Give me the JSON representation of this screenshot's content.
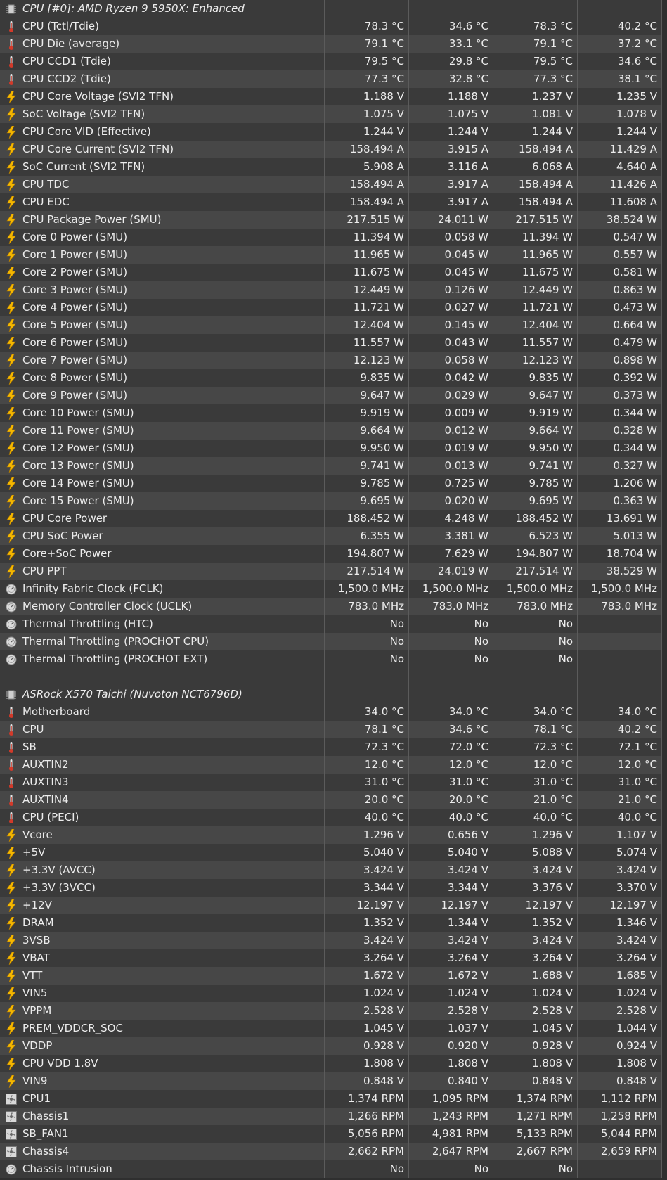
{
  "columns": [
    "",
    "",
    "",
    ""
  ],
  "sections": [
    {
      "title": "CPU [#0]: AMD Ryzen 9 5950X: Enhanced",
      "icon": "chip-icon",
      "rows": [
        {
          "label": "CPU (Tctl/Tdie)",
          "icon": "thermometer-icon",
          "values": [
            "78.3 °C",
            "34.6 °C",
            "78.3 °C",
            "40.2 °C"
          ]
        },
        {
          "label": "CPU Die (average)",
          "icon": "thermometer-icon",
          "values": [
            "79.1 °C",
            "33.1 °C",
            "79.1 °C",
            "37.2 °C"
          ]
        },
        {
          "label": "CPU CCD1 (Tdie)",
          "icon": "thermometer-icon",
          "values": [
            "79.5 °C",
            "29.8 °C",
            "79.5 °C",
            "34.6 °C"
          ]
        },
        {
          "label": "CPU CCD2 (Tdie)",
          "icon": "thermometer-icon",
          "values": [
            "77.3 °C",
            "32.8 °C",
            "77.3 °C",
            "38.1 °C"
          ]
        },
        {
          "label": "CPU Core Voltage (SVI2 TFN)",
          "icon": "lightning-icon",
          "values": [
            "1.188 V",
            "1.188 V",
            "1.237 V",
            "1.235 V"
          ]
        },
        {
          "label": "SoC Voltage (SVI2 TFN)",
          "icon": "lightning-icon",
          "values": [
            "1.075 V",
            "1.075 V",
            "1.081 V",
            "1.078 V"
          ]
        },
        {
          "label": "CPU Core VID (Effective)",
          "icon": "lightning-icon",
          "values": [
            "1.244 V",
            "1.244 V",
            "1.244 V",
            "1.244 V"
          ]
        },
        {
          "label": "CPU Core Current (SVI2 TFN)",
          "icon": "lightning-icon",
          "values": [
            "158.494 A",
            "3.915 A",
            "158.494 A",
            "11.429 A"
          ]
        },
        {
          "label": "SoC Current (SVI2 TFN)",
          "icon": "lightning-icon",
          "values": [
            "5.908 A",
            "3.116 A",
            "6.068 A",
            "4.640 A"
          ]
        },
        {
          "label": "CPU TDC",
          "icon": "lightning-icon",
          "values": [
            "158.494 A",
            "3.917 A",
            "158.494 A",
            "11.426 A"
          ]
        },
        {
          "label": "CPU EDC",
          "icon": "lightning-icon",
          "values": [
            "158.494 A",
            "3.917 A",
            "158.494 A",
            "11.608 A"
          ]
        },
        {
          "label": "CPU Package Power (SMU)",
          "icon": "lightning-icon",
          "values": [
            "217.515 W",
            "24.011 W",
            "217.515 W",
            "38.524 W"
          ]
        },
        {
          "label": "Core 0 Power (SMU)",
          "icon": "lightning-icon",
          "values": [
            "11.394 W",
            "0.058 W",
            "11.394 W",
            "0.547 W"
          ]
        },
        {
          "label": "Core 1 Power (SMU)",
          "icon": "lightning-icon",
          "values": [
            "11.965 W",
            "0.045 W",
            "11.965 W",
            "0.557 W"
          ]
        },
        {
          "label": "Core 2 Power (SMU)",
          "icon": "lightning-icon",
          "values": [
            "11.675 W",
            "0.045 W",
            "11.675 W",
            "0.581 W"
          ]
        },
        {
          "label": "Core 3 Power (SMU)",
          "icon": "lightning-icon",
          "values": [
            "12.449 W",
            "0.126 W",
            "12.449 W",
            "0.863 W"
          ]
        },
        {
          "label": "Core 4 Power (SMU)",
          "icon": "lightning-icon",
          "values": [
            "11.721 W",
            "0.027 W",
            "11.721 W",
            "0.473 W"
          ]
        },
        {
          "label": "Core 5 Power (SMU)",
          "icon": "lightning-icon",
          "values": [
            "12.404 W",
            "0.145 W",
            "12.404 W",
            "0.664 W"
          ]
        },
        {
          "label": "Core 6 Power (SMU)",
          "icon": "lightning-icon",
          "values": [
            "11.557 W",
            "0.043 W",
            "11.557 W",
            "0.479 W"
          ]
        },
        {
          "label": "Core 7 Power (SMU)",
          "icon": "lightning-icon",
          "values": [
            "12.123 W",
            "0.058 W",
            "12.123 W",
            "0.898 W"
          ]
        },
        {
          "label": "Core 8 Power (SMU)",
          "icon": "lightning-icon",
          "values": [
            "9.835 W",
            "0.042 W",
            "9.835 W",
            "0.392 W"
          ]
        },
        {
          "label": "Core 9 Power (SMU)",
          "icon": "lightning-icon",
          "values": [
            "9.647 W",
            "0.029 W",
            "9.647 W",
            "0.373 W"
          ]
        },
        {
          "label": "Core 10 Power (SMU)",
          "icon": "lightning-icon",
          "values": [
            "9.919 W",
            "0.009 W",
            "9.919 W",
            "0.344 W"
          ]
        },
        {
          "label": "Core 11 Power (SMU)",
          "icon": "lightning-icon",
          "values": [
            "9.664 W",
            "0.012 W",
            "9.664 W",
            "0.328 W"
          ]
        },
        {
          "label": "Core 12 Power (SMU)",
          "icon": "lightning-icon",
          "values": [
            "9.950 W",
            "0.019 W",
            "9.950 W",
            "0.344 W"
          ]
        },
        {
          "label": "Core 13 Power (SMU)",
          "icon": "lightning-icon",
          "values": [
            "9.741 W",
            "0.013 W",
            "9.741 W",
            "0.327 W"
          ]
        },
        {
          "label": "Core 14 Power (SMU)",
          "icon": "lightning-icon",
          "values": [
            "9.785 W",
            "0.725 W",
            "9.785 W",
            "1.206 W"
          ]
        },
        {
          "label": "Core 15 Power (SMU)",
          "icon": "lightning-icon",
          "values": [
            "9.695 W",
            "0.020 W",
            "9.695 W",
            "0.363 W"
          ]
        },
        {
          "label": "CPU Core Power",
          "icon": "lightning-icon",
          "values": [
            "188.452 W",
            "4.248 W",
            "188.452 W",
            "13.691 W"
          ]
        },
        {
          "label": "CPU SoC Power",
          "icon": "lightning-icon",
          "values": [
            "6.355 W",
            "3.381 W",
            "6.523 W",
            "5.013 W"
          ]
        },
        {
          "label": "Core+SoC Power",
          "icon": "lightning-icon",
          "values": [
            "194.807 W",
            "7.629 W",
            "194.807 W",
            "18.704 W"
          ]
        },
        {
          "label": "CPU PPT",
          "icon": "lightning-icon",
          "values": [
            "217.514 W",
            "24.019 W",
            "217.514 W",
            "38.529 W"
          ]
        },
        {
          "label": "Infinity Fabric Clock (FCLK)",
          "icon": "clock-icon",
          "values": [
            "1,500.0 MHz",
            "1,500.0 MHz",
            "1,500.0 MHz",
            "1,500.0 MHz"
          ]
        },
        {
          "label": "Memory Controller Clock (UCLK)",
          "icon": "clock-icon",
          "values": [
            "783.0 MHz",
            "783.0 MHz",
            "783.0 MHz",
            "783.0 MHz"
          ]
        },
        {
          "label": "Thermal Throttling (HTC)",
          "icon": "clock-icon",
          "values": [
            "No",
            "No",
            "No",
            ""
          ]
        },
        {
          "label": "Thermal Throttling (PROCHOT CPU)",
          "icon": "clock-icon",
          "values": [
            "No",
            "No",
            "No",
            ""
          ]
        },
        {
          "label": "Thermal Throttling (PROCHOT EXT)",
          "icon": "clock-icon",
          "values": [
            "No",
            "No",
            "No",
            ""
          ]
        }
      ]
    },
    {
      "title": "ASRock X570 Taichi (Nuvoton NCT6796D)",
      "icon": "chip-icon",
      "rows": [
        {
          "label": "Motherboard",
          "icon": "thermometer-icon",
          "values": [
            "34.0 °C",
            "34.0 °C",
            "34.0 °C",
            "34.0 °C"
          ]
        },
        {
          "label": "CPU",
          "icon": "thermometer-icon",
          "values": [
            "78.1 °C",
            "34.6 °C",
            "78.1 °C",
            "40.2 °C"
          ]
        },
        {
          "label": "SB",
          "icon": "thermometer-icon",
          "values": [
            "72.3 °C",
            "72.0 °C",
            "72.3 °C",
            "72.1 °C"
          ]
        },
        {
          "label": "AUXTIN2",
          "icon": "thermometer-icon",
          "values": [
            "12.0 °C",
            "12.0 °C",
            "12.0 °C",
            "12.0 °C"
          ]
        },
        {
          "label": "AUXTIN3",
          "icon": "thermometer-icon",
          "values": [
            "31.0 °C",
            "31.0 °C",
            "31.0 °C",
            "31.0 °C"
          ]
        },
        {
          "label": "AUXTIN4",
          "icon": "thermometer-icon",
          "values": [
            "20.0 °C",
            "20.0 °C",
            "21.0 °C",
            "21.0 °C"
          ]
        },
        {
          "label": "CPU (PECI)",
          "icon": "thermometer-icon",
          "values": [
            "40.0 °C",
            "40.0 °C",
            "40.0 °C",
            "40.0 °C"
          ]
        },
        {
          "label": "Vcore",
          "icon": "lightning-icon",
          "values": [
            "1.296 V",
            "0.656 V",
            "1.296 V",
            "1.107 V"
          ]
        },
        {
          "label": "+5V",
          "icon": "lightning-icon",
          "values": [
            "5.040 V",
            "5.040 V",
            "5.088 V",
            "5.074 V"
          ]
        },
        {
          "label": "+3.3V (AVCC)",
          "icon": "lightning-icon",
          "values": [
            "3.424 V",
            "3.424 V",
            "3.424 V",
            "3.424 V"
          ]
        },
        {
          "label": "+3.3V (3VCC)",
          "icon": "lightning-icon",
          "values": [
            "3.344 V",
            "3.344 V",
            "3.376 V",
            "3.370 V"
          ]
        },
        {
          "label": "+12V",
          "icon": "lightning-icon",
          "values": [
            "12.197 V",
            "12.197 V",
            "12.197 V",
            "12.197 V"
          ]
        },
        {
          "label": "DRAM",
          "icon": "lightning-icon",
          "values": [
            "1.352 V",
            "1.344 V",
            "1.352 V",
            "1.346 V"
          ]
        },
        {
          "label": "3VSB",
          "icon": "lightning-icon",
          "values": [
            "3.424 V",
            "3.424 V",
            "3.424 V",
            "3.424 V"
          ]
        },
        {
          "label": "VBAT",
          "icon": "lightning-icon",
          "values": [
            "3.264 V",
            "3.264 V",
            "3.264 V",
            "3.264 V"
          ]
        },
        {
          "label": "VTT",
          "icon": "lightning-icon",
          "values": [
            "1.672 V",
            "1.672 V",
            "1.688 V",
            "1.685 V"
          ]
        },
        {
          "label": "VIN5",
          "icon": "lightning-icon",
          "values": [
            "1.024 V",
            "1.024 V",
            "1.024 V",
            "1.024 V"
          ]
        },
        {
          "label": "VPPM",
          "icon": "lightning-icon",
          "values": [
            "2.528 V",
            "2.528 V",
            "2.528 V",
            "2.528 V"
          ]
        },
        {
          "label": "PREM_VDDCR_SOC",
          "icon": "lightning-icon",
          "values": [
            "1.045 V",
            "1.037 V",
            "1.045 V",
            "1.044 V"
          ]
        },
        {
          "label": "VDDP",
          "icon": "lightning-icon",
          "values": [
            "0.928 V",
            "0.920 V",
            "0.928 V",
            "0.924 V"
          ]
        },
        {
          "label": "CPU VDD 1.8V",
          "icon": "lightning-icon",
          "values": [
            "1.808 V",
            "1.808 V",
            "1.808 V",
            "1.808 V"
          ]
        },
        {
          "label": "VIN9",
          "icon": "lightning-icon",
          "values": [
            "0.848 V",
            "0.840 V",
            "0.848 V",
            "0.848 V"
          ]
        },
        {
          "label": "CPU1",
          "icon": "fan-icon",
          "values": [
            "1,374 RPM",
            "1,095 RPM",
            "1,374 RPM",
            "1,112 RPM"
          ]
        },
        {
          "label": "Chassis1",
          "icon": "fan-icon",
          "values": [
            "1,266 RPM",
            "1,243 RPM",
            "1,271 RPM",
            "1,258 RPM"
          ]
        },
        {
          "label": "SB_FAN1",
          "icon": "fan-icon",
          "values": [
            "5,056 RPM",
            "4,981 RPM",
            "5,133 RPM",
            "5,044 RPM"
          ]
        },
        {
          "label": "Chassis4",
          "icon": "fan-icon",
          "values": [
            "2,662 RPM",
            "2,647 RPM",
            "2,667 RPM",
            "2,659 RPM"
          ]
        },
        {
          "label": "Chassis Intrusion",
          "icon": "clock-icon",
          "values": [
            "No",
            "No",
            "No",
            ""
          ]
        }
      ]
    }
  ],
  "colors": {
    "background": "#2f2f2f",
    "row_odd": "#3a3a3a",
    "row_even": "#474747",
    "grid_line": "#5b5b5b",
    "text": "#ececec",
    "lightning": "#f5b800",
    "thermometer": "#d23a2a"
  }
}
